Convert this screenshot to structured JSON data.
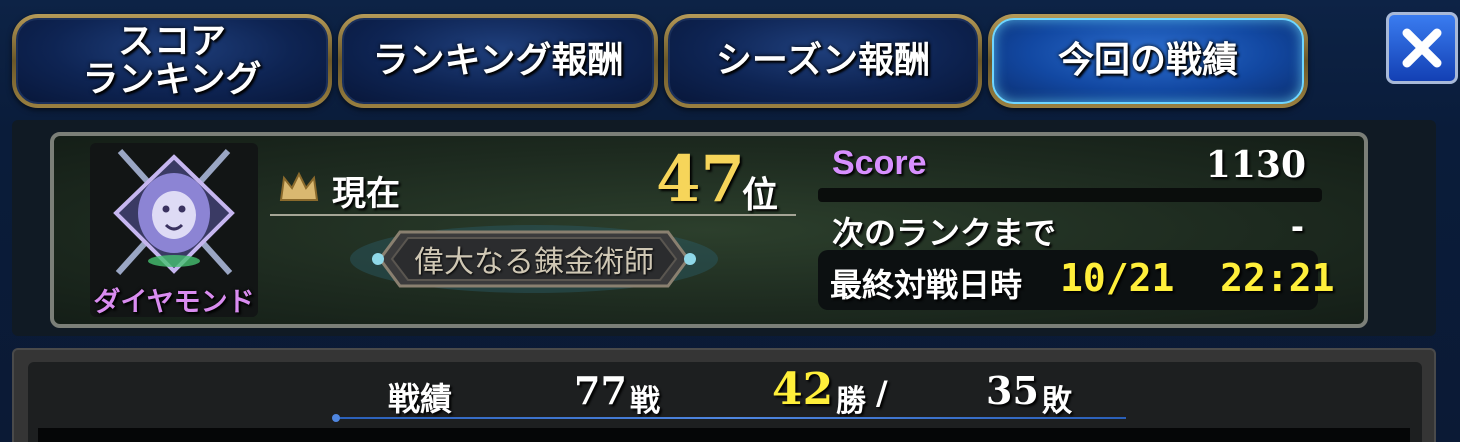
{
  "tabs": [
    {
      "label": "スコア\nランキング",
      "active": false
    },
    {
      "label": "ランキング報酬",
      "active": false
    },
    {
      "label": "シーズン報酬",
      "active": false
    },
    {
      "label": "今回の戦績",
      "active": true
    }
  ],
  "close_icon": "close-x-icon",
  "rank_emblem": {
    "icon": "lion-crest-icon",
    "label": "ダイヤモンド"
  },
  "current": {
    "crown_icon": "crown-icon",
    "label": "現在",
    "rank": "47",
    "rank_suffix": "位"
  },
  "title_badge": "偉大なる錬金術師",
  "score": {
    "label": "Score",
    "value": "1130"
  },
  "next_rank": {
    "label": "次のランクまで",
    "value": "-"
  },
  "last_battle": {
    "label": "最終対戦日時",
    "value": "10/21  22:21"
  },
  "record": {
    "label": "戦績",
    "battles": "77",
    "battles_unit": "戦",
    "wins": "42",
    "wins_unit": "勝",
    "separator": "/",
    "losses": "35",
    "losses_unit": "敗"
  },
  "colors": {
    "gold": "#f6d55a",
    "yellow": "#ffef3a",
    "score_purple": "#d890ff",
    "active_tab": "#1e5fc7"
  }
}
